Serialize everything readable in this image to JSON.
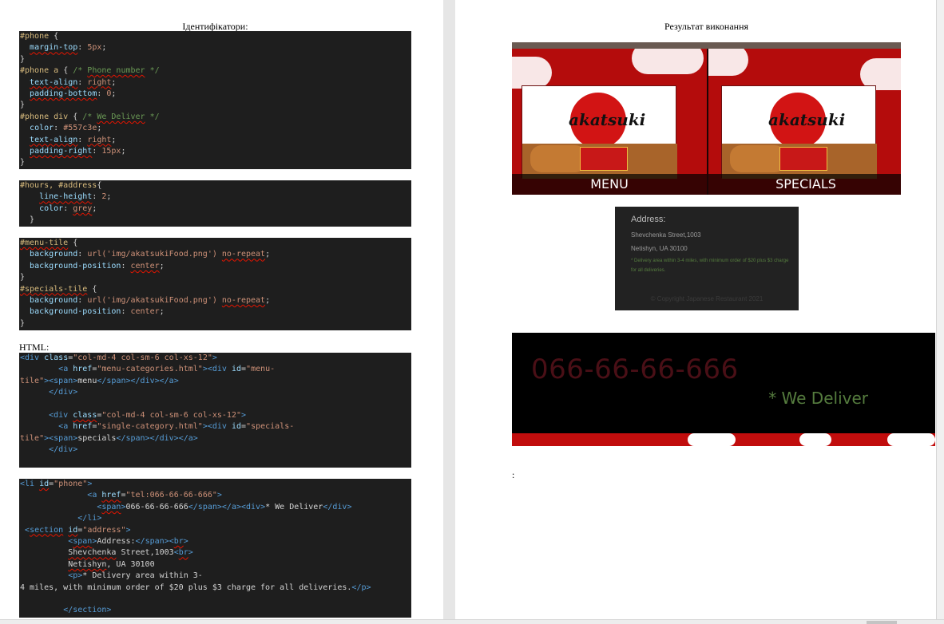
{
  "left": {
    "heading": "Ідентифікатори:",
    "html_label": "HTML:"
  },
  "right": {
    "heading": "Результат виконання",
    "colon": ":"
  },
  "tiles": {
    "menu_label": "MENU",
    "specials_label": "SPECIALS",
    "logo_text": "akatsuki"
  },
  "address": {
    "title": "Address:",
    "street": "Shevchenka Street,1003",
    "city": "Netishyn, UA 30100",
    "delivery": "* Delivery area within 3-4 miles, with minimum order of $20 plus $3 charge for all deliveries.",
    "copyright": "© Copyright Japanese Restaurant 2021"
  },
  "phone": {
    "number": "066-66-66-666",
    "deliver": "* We Deliver"
  },
  "colors": {
    "editor_bg": "#1e1e1e",
    "deliver_green": "#557c3e",
    "brand_red": "#c10d0d"
  }
}
